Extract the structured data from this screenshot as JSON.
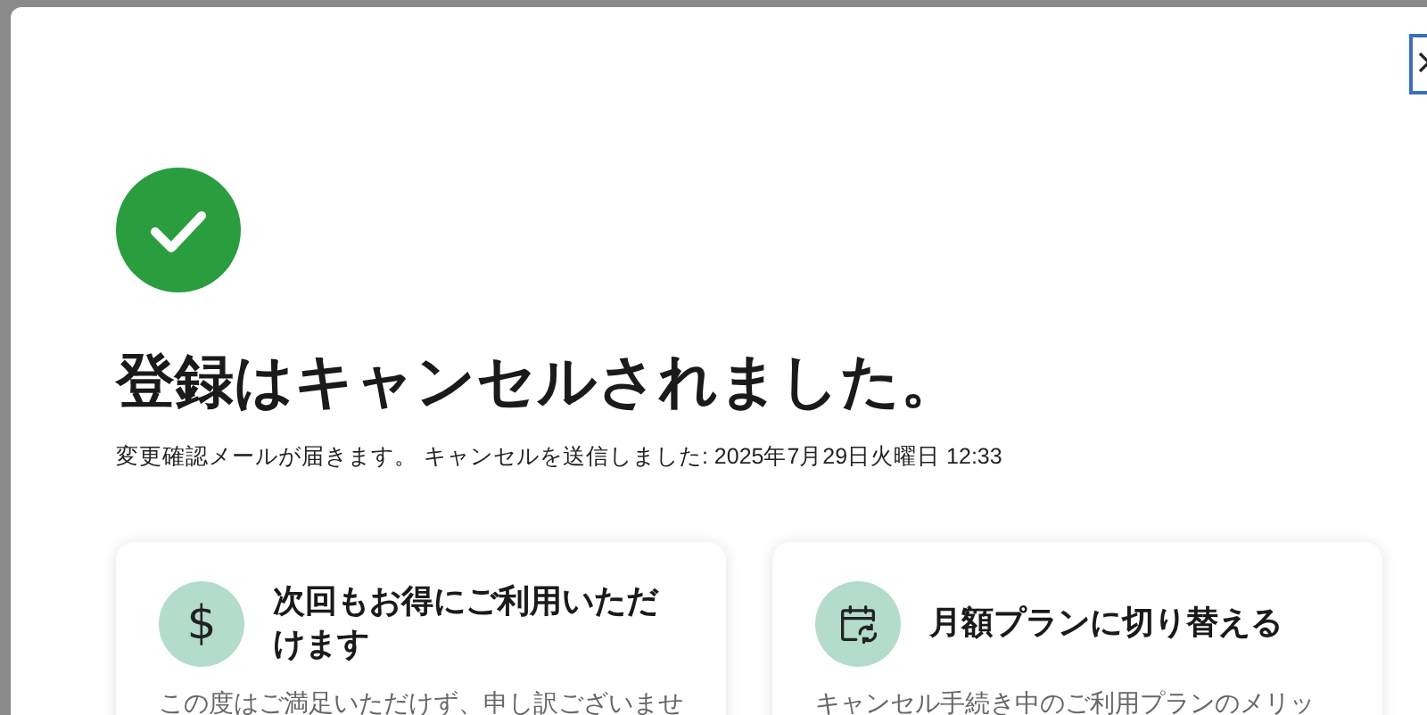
{
  "dialog": {
    "title": "登録はキャンセルされました。",
    "subtitle": "変更確認メールが届きます。 キャンセルを送信しました: 2025年7月29日火曜日 12:33",
    "cards": [
      {
        "kind": "dollar",
        "icon_text": "$",
        "title": "次回もお得にご利用いただけます",
        "body": "この度はご満足いただけず、申し訳ございませ"
      },
      {
        "kind": "calendar",
        "title": "月額プランに切り替える",
        "body": "キャンセル手続き中のご利用プランのメリッ"
      }
    ]
  }
}
